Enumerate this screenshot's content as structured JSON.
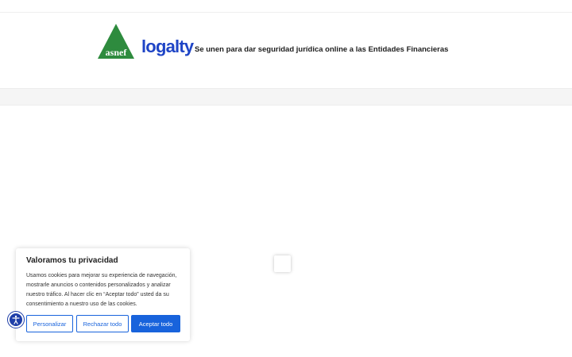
{
  "header": {
    "logo_asnef_text": "asnef",
    "logo_logalty_text": "logalty",
    "headline": "Se unen para dar seguridad jurídica online a las Entidades Financieras"
  },
  "cookie_banner": {
    "title": "Valoramos tu privacidad",
    "body": "Usamos cookies para mejorar su experiencia de navegación, mostrarle anuncios o contenidos personalizados y analizar nuestro tráfico. Al hacer clic en “Aceptar todo” usted da su consentimiento a nuestro uso de las cookies.",
    "buttons": {
      "personalize": "Personalizar",
      "reject": "Rechazar todo",
      "accept": "Aceptar todo"
    }
  },
  "colors": {
    "accent": "#1863dc",
    "logalty_blue": "#1f45c6",
    "asnef_green": "#2e8b3e"
  },
  "icons": {
    "accessibility": "accessibility-icon",
    "asnef_logo": "asnef-logo-icon"
  }
}
